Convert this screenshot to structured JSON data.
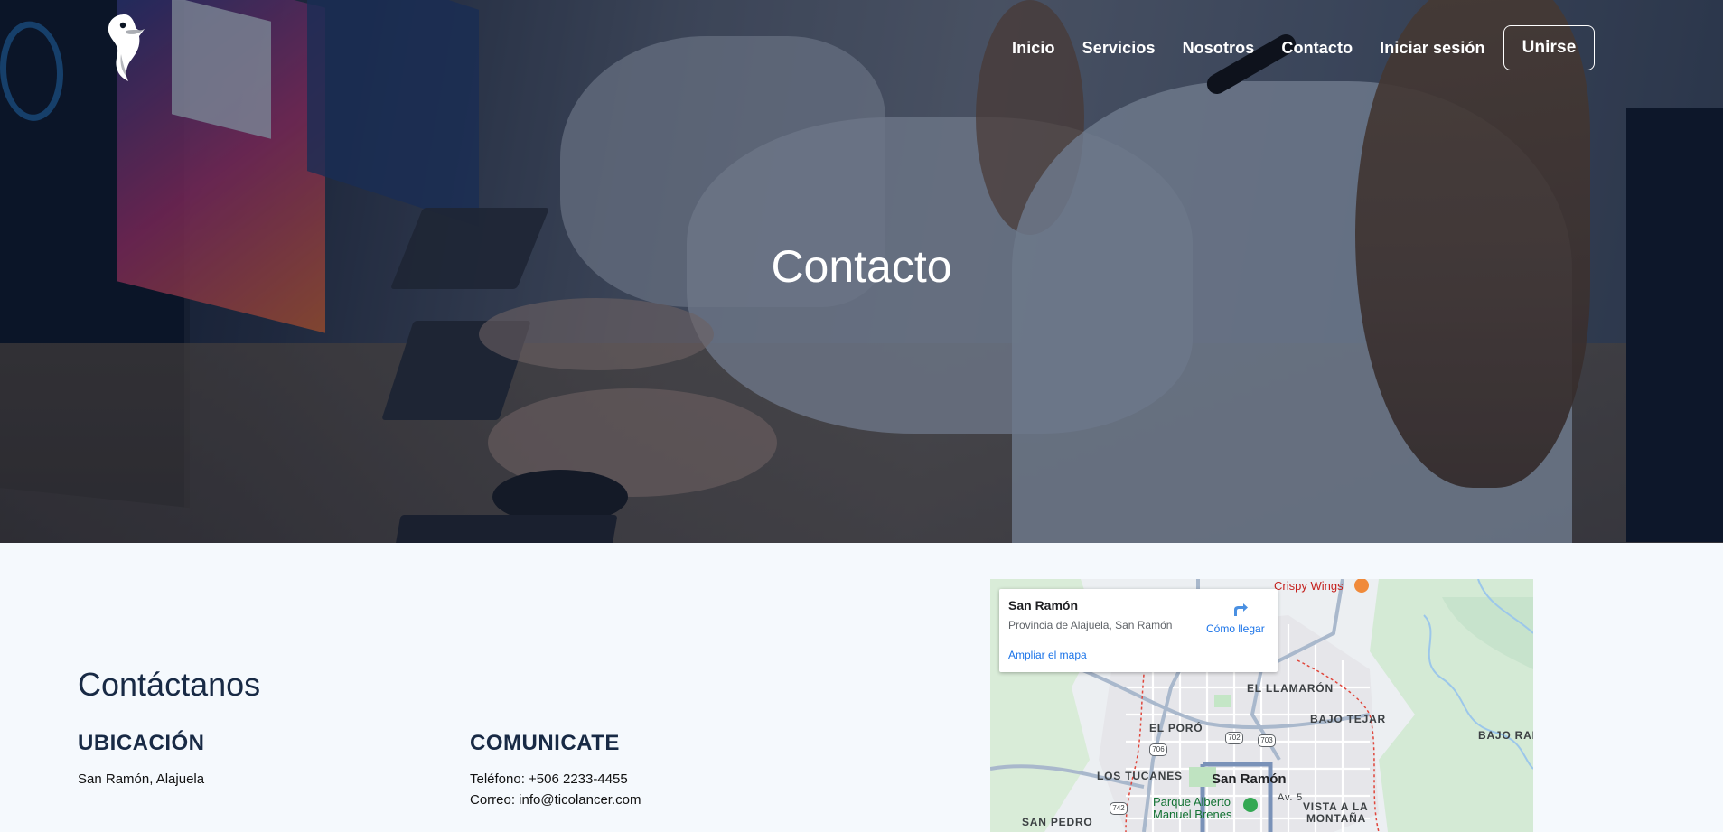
{
  "header": {
    "logo_name": "toucan-logo",
    "nav": [
      {
        "label": "Inicio"
      },
      {
        "label": "Servicios"
      },
      {
        "label": "Nosotros"
      },
      {
        "label": "Contacto"
      },
      {
        "label": "Iniciar sesión"
      }
    ],
    "join_label": "Unirse"
  },
  "hero": {
    "title": "Contacto"
  },
  "contact": {
    "heading": "Contáctanos",
    "location": {
      "title": "UBICACIÓN",
      "text": "San Ramón, Alajuela"
    },
    "communicate": {
      "title": "COMUNICATE",
      "phone": "Teléfono: +506 2233-4455",
      "email": "Correo: info@ticolancer.com"
    }
  },
  "map": {
    "place_name": "San Ramón",
    "address": "Provincia de Alajuela, San Ramón",
    "directions_label": "Cómo llegar",
    "enlarge_label": "Ampliar el mapa",
    "labels": {
      "crispy": "Crispy Wings",
      "llamaron": "EL LLAMARÓN",
      "bajo_tejar": "BAJO TEJAR",
      "bajo_ra": "BAJO RAN",
      "el_poro": "EL PORÓ",
      "los_tucanes": "LOS TUCANES",
      "san_ramon": "San Ramón",
      "parque_1": "Parque Alberto",
      "parque_2": "Manuel Brenes",
      "vista_1": "VISTA A LA",
      "vista_2": "MONTAÑA",
      "san_pedro": "SAN PEDRO",
      "av5": "Av. 5"
    },
    "shields": [
      "702",
      "703",
      "706",
      "742"
    ]
  }
}
